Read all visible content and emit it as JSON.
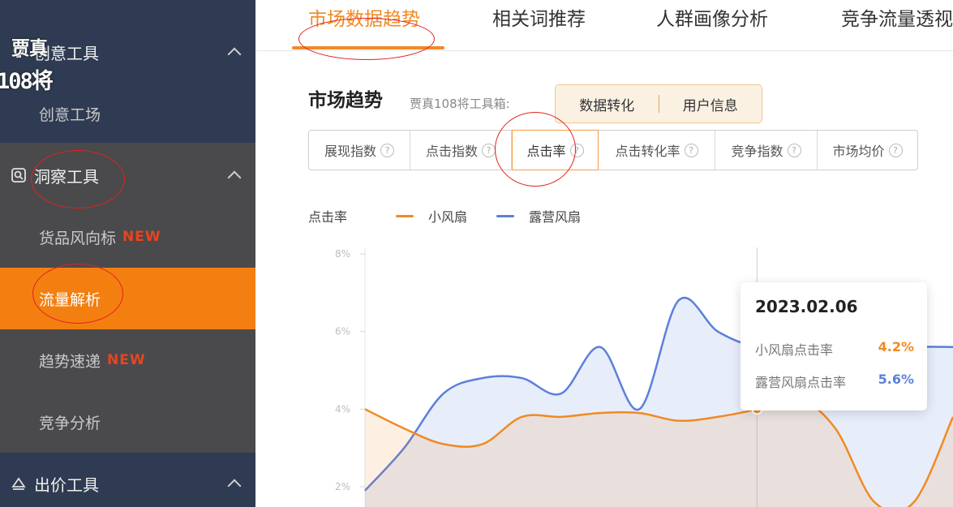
{
  "logo": {
    "top": "贾真",
    "bottom": "108将"
  },
  "sidebar": {
    "groups": [
      {
        "label": "创意工具",
        "icon": "lightbulb-icon",
        "items": [
          {
            "label": "创意工场",
            "badge": ""
          }
        ]
      },
      {
        "label": "洞察工具",
        "icon": "insight-icon",
        "items": [
          {
            "label": "货品风向标",
            "badge": "NEW"
          },
          {
            "label": "流量解析",
            "badge": ""
          },
          {
            "label": "趋势速递",
            "badge": "NEW"
          },
          {
            "label": "竞争分析",
            "badge": ""
          }
        ]
      },
      {
        "label": "出价工具",
        "icon": "bid-icon",
        "items": []
      }
    ],
    "active_item": "流量解析"
  },
  "tabs": [
    {
      "label": "市场数据趋势",
      "active": true
    },
    {
      "label": "相关词推荐",
      "active": false
    },
    {
      "label": "人群画像分析",
      "active": false
    },
    {
      "label": "竞争流量透视",
      "active": false
    }
  ],
  "section": {
    "title": "市场趋势",
    "toolbox_label": "贾真108将工具箱:",
    "toolbox_buttons": [
      "数据转化",
      "用户信息"
    ]
  },
  "metrics": [
    {
      "label": "展现指数",
      "selected": false
    },
    {
      "label": "点击指数",
      "selected": false
    },
    {
      "label": "点击率",
      "selected": true
    },
    {
      "label": "点击转化率",
      "selected": false
    },
    {
      "label": "竞争指数",
      "selected": false
    },
    {
      "label": "市场均价",
      "selected": false
    }
  ],
  "help_glyph": "?",
  "chart_data": {
    "type": "area",
    "ylabel": "点击率",
    "yticks": [
      "8%",
      "6%",
      "4%",
      "2%"
    ],
    "ylim": [
      2,
      8
    ],
    "x": [
      0,
      1,
      2,
      3,
      4,
      5,
      6,
      7,
      8,
      9,
      10,
      11,
      12,
      13,
      14,
      15
    ],
    "series": [
      {
        "name": "小风扇",
        "color": "#f08a24",
        "values": [
          4.0,
          3.5,
          3.1,
          3.1,
          3.8,
          3.8,
          3.9,
          3.9,
          3.7,
          3.8,
          4.0,
          4.3,
          3.5,
          1.6,
          1.6,
          3.8
        ]
      },
      {
        "name": "露营风扇",
        "color": "#5b7fdc",
        "values": [
          1.9,
          3.0,
          4.4,
          4.8,
          4.8,
          4.4,
          5.6,
          4.0,
          6.8,
          6.0,
          5.6,
          5.6,
          5.5,
          5.5,
          5.6,
          5.6
        ]
      }
    ],
    "highlight_index": 10,
    "tooltip": {
      "date": "2023.02.06",
      "rows": [
        {
          "label": "小风扇点击率",
          "value": "4.2%",
          "color": "#f08a24"
        },
        {
          "label": "露营风扇点击率",
          "value": "5.6%",
          "color": "#5b7fdc"
        }
      ]
    }
  }
}
